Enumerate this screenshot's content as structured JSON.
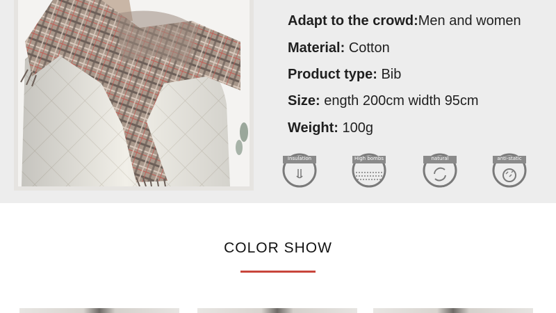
{
  "specs": [
    {
      "key": "Adapt to the crowd:",
      "value": "Men and women"
    },
    {
      "key": "Material: ",
      "value": "Cotton"
    },
    {
      "key": "Product type: ",
      "value": "Bib"
    },
    {
      "key": "Size: ",
      "value": "ength 200cm width 95cm"
    },
    {
      "key": "Weight: ",
      "value": "100g"
    }
  ],
  "badges": [
    {
      "label": "Insulation",
      "icon": "insulation-icon"
    },
    {
      "label": "High bombs",
      "icon": "fluffy-icon"
    },
    {
      "label": "natural",
      "icon": "natural-icon"
    },
    {
      "label": "anti-static",
      "icon": "anti-static-icon"
    }
  ],
  "color_show": {
    "title": "COLOR  SHOW",
    "accent_color": "#c8453b"
  }
}
